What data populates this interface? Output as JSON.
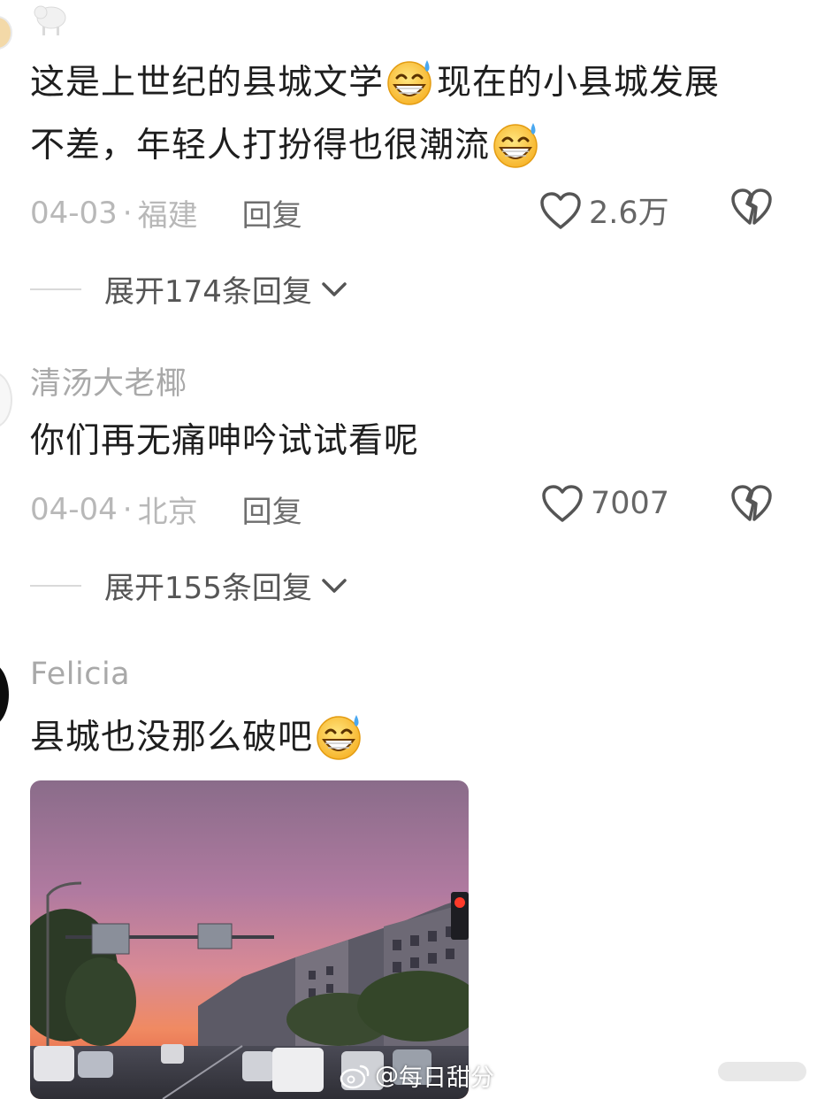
{
  "comments": [
    {
      "text_line1": "这是上世纪的县城文学",
      "text_line1b": "现在的小县城发展",
      "text_line2": "不差，年轻人打扮得也很潮流",
      "date": "04-03",
      "location": "福建",
      "reply_label": "回复",
      "likes": "2.6万",
      "expand_label": "展开174条回复"
    },
    {
      "username": "清汤大老椰",
      "text": "你们再无痛呻吟试试看呢",
      "date": "04-04",
      "location": "北京",
      "reply_label": "回复",
      "likes": "7007",
      "expand_label": "展开155条回复"
    },
    {
      "username": "Felicia",
      "text": "县城也没那么破吧"
    }
  ],
  "meta_separator": "·",
  "watermark": {
    "prefix": "@",
    "name": "每日甜分"
  },
  "colors": {
    "username": "#a9a9a9",
    "meta": "#b8b8b8",
    "body_text": "#1e1e1e"
  },
  "icons": [
    "sweat-smile-emoji",
    "heart-icon",
    "broken-heart-icon",
    "chevron-down-icon",
    "weibo-logo-icon"
  ]
}
